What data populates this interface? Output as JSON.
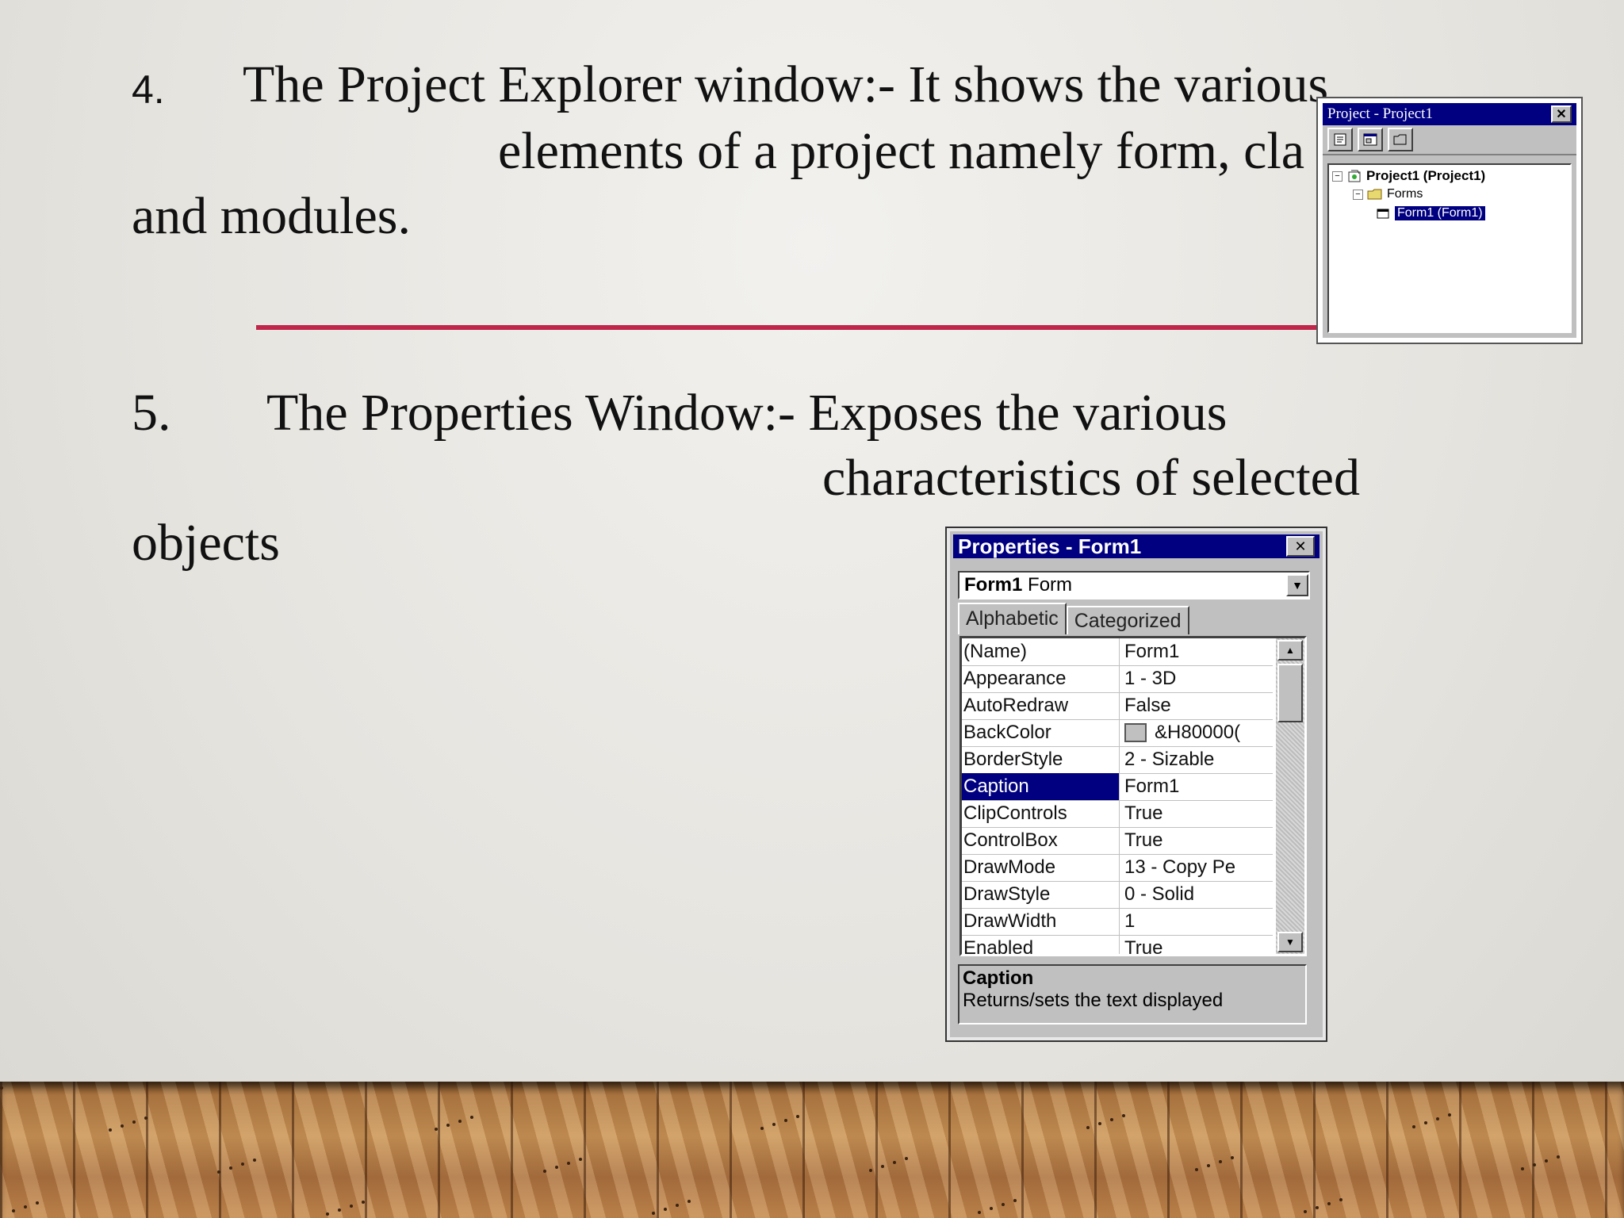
{
  "slide": {
    "item4_number": "4.",
    "item4_line1": "The Project Explorer window:- It shows the various",
    "item4_line2": "elements of a project namely form, cla",
    "item4_line3": "and modules.",
    "item5_number": "5.",
    "item5_line1": "The Properties Window:- Exposes the various",
    "item5_line2": "characteristics of selected",
    "item5_line3": "objects",
    "divider_color": "#c0254a"
  },
  "project_explorer": {
    "title": "Project - Project1",
    "close_label": "✕",
    "toolbar": [
      {
        "icon": "view-code-icon"
      },
      {
        "icon": "view-object-icon"
      },
      {
        "icon": "toggle-folders-icon"
      }
    ],
    "tree": {
      "project": "Project1 (Project1)",
      "forms_folder": "Forms",
      "form_item": "Form1 (Form1)"
    }
  },
  "properties": {
    "title": "Properties - Form1",
    "close_label": "✕",
    "object_name": "Form1",
    "object_type": "Form",
    "tabs": [
      "Alphabetic",
      "Categorized"
    ],
    "active_tab": "Alphabetic",
    "rows": [
      {
        "name": "(Name)",
        "value": "Form1"
      },
      {
        "name": "Appearance",
        "value": "1 - 3D"
      },
      {
        "name": "AutoRedraw",
        "value": "False"
      },
      {
        "name": "BackColor",
        "value": "&H80000("
      },
      {
        "name": "BorderStyle",
        "value": "2 - Sizable"
      },
      {
        "name": "Caption",
        "value": "Form1"
      },
      {
        "name": "ClipControls",
        "value": "True"
      },
      {
        "name": "ControlBox",
        "value": "True"
      },
      {
        "name": "DrawMode",
        "value": "13 - Copy Pe"
      },
      {
        "name": "DrawStyle",
        "value": "0 - Solid"
      },
      {
        "name": "DrawWidth",
        "value": "1"
      },
      {
        "name": "Enabled",
        "value": "True"
      }
    ],
    "selected_row": "Caption",
    "description_title": "Caption",
    "description_text": "Returns/sets the text displayed"
  }
}
